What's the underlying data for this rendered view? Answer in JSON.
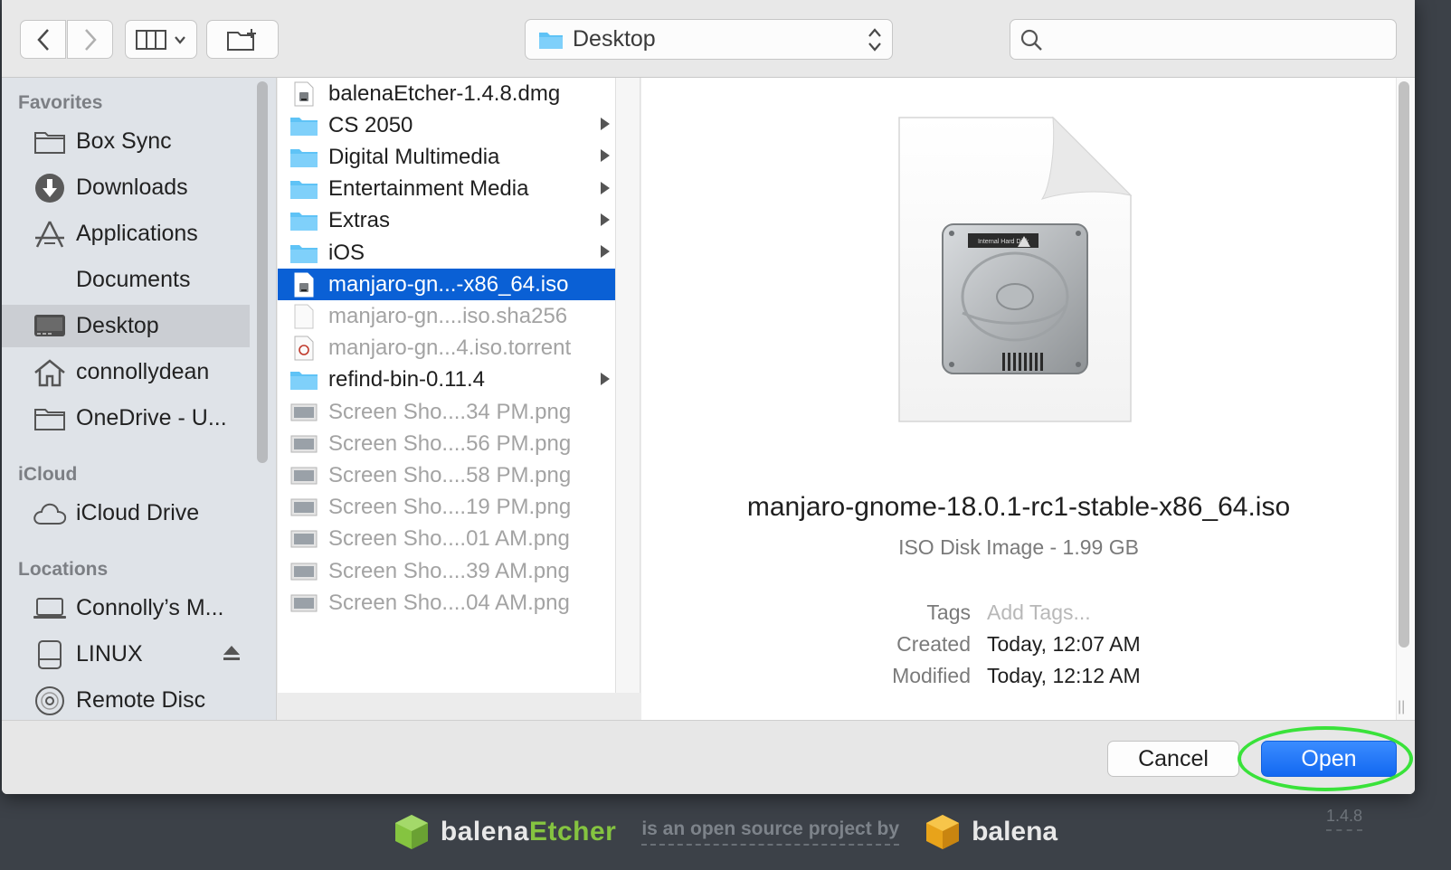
{
  "dialog": {
    "location": "Desktop",
    "search": {
      "value": "",
      "placeholder": ""
    },
    "buttons": {
      "cancel": "Cancel",
      "open": "Open"
    }
  },
  "sidebar": {
    "sections": [
      {
        "title": "Favorites",
        "items": [
          {
            "label": "Box Sync",
            "icon": "folder-icon"
          },
          {
            "label": "Downloads",
            "icon": "downloads-icon"
          },
          {
            "label": "Applications",
            "icon": "applications-icon"
          },
          {
            "label": "Documents",
            "icon": "none"
          },
          {
            "label": "Desktop",
            "icon": "desktop-icon",
            "selected": true
          },
          {
            "label": "connollydean",
            "icon": "home-icon"
          },
          {
            "label": "OneDrive - U...",
            "icon": "folder-icon"
          }
        ]
      },
      {
        "title": "iCloud",
        "items": [
          {
            "label": "iCloud Drive",
            "icon": "cloud-icon"
          }
        ]
      },
      {
        "title": "Locations",
        "items": [
          {
            "label": "Connolly’s M...",
            "icon": "laptop-icon"
          },
          {
            "label": "LINUX",
            "icon": "drive-icon",
            "eject": true
          },
          {
            "label": "Remote Disc",
            "icon": "disc-icon"
          }
        ]
      }
    ]
  },
  "files": [
    {
      "name": "balenaEtcher-1.4.8.dmg",
      "kind": "dmg",
      "dim": false,
      "folder": false
    },
    {
      "name": "CS 2050",
      "kind": "folder",
      "dim": false,
      "folder": true
    },
    {
      "name": "Digital Multimedia",
      "kind": "folder",
      "dim": false,
      "folder": true
    },
    {
      "name": "Entertainment Media",
      "kind": "folder",
      "dim": false,
      "folder": true
    },
    {
      "name": "Extras",
      "kind": "folder",
      "dim": false,
      "folder": true
    },
    {
      "name": "iOS",
      "kind": "folder",
      "dim": false,
      "folder": true
    },
    {
      "name": "manjaro-gn...-x86_64.iso",
      "kind": "iso",
      "dim": false,
      "folder": false,
      "selected": true
    },
    {
      "name": "manjaro-gn....iso.sha256",
      "kind": "doc",
      "dim": true,
      "folder": false
    },
    {
      "name": "manjaro-gn...4.iso.torrent",
      "kind": "torrent",
      "dim": true,
      "folder": false
    },
    {
      "name": "refind-bin-0.11.4",
      "kind": "folder",
      "dim": false,
      "folder": true
    },
    {
      "name": "Screen Sho....34 PM.png",
      "kind": "png",
      "dim": true,
      "folder": false
    },
    {
      "name": "Screen Sho....56 PM.png",
      "kind": "png",
      "dim": true,
      "folder": false
    },
    {
      "name": "Screen Sho....58 PM.png",
      "kind": "png",
      "dim": true,
      "folder": false
    },
    {
      "name": "Screen Sho....19 PM.png",
      "kind": "png",
      "dim": true,
      "folder": false
    },
    {
      "name": "Screen Sho....01 AM.png",
      "kind": "png",
      "dim": true,
      "folder": false
    },
    {
      "name": "Screen Sho....39 AM.png",
      "kind": "png",
      "dim": true,
      "folder": false
    },
    {
      "name": "Screen Sho....04 AM.png",
      "kind": "png",
      "dim": true,
      "folder": false
    }
  ],
  "preview": {
    "file_name": "manjaro-gnome-18.0.1-rc1-stable-x86_64.iso",
    "kind": "ISO Disk Image - 1.99 GB",
    "tags_label": "Tags",
    "tags_value": "Add Tags...",
    "created_label": "Created",
    "created_value": "Today, 12:07 AM",
    "modified_label": "Modified",
    "modified_value": "Today, 12:12 AM",
    "disk_label": "Internal Hard Disk"
  },
  "background_app": {
    "brand_prefix": "balena",
    "brand_suffix": "Etcher",
    "tagline": "is an open source project by",
    "company": "balena",
    "version": "1.4.8"
  },
  "colors": {
    "selection": "#0a60d5",
    "open_button": "#1268f1",
    "highlight_ring": "#39e23a",
    "folder": "#5fc3f6",
    "etcher_green": "#85c440"
  }
}
